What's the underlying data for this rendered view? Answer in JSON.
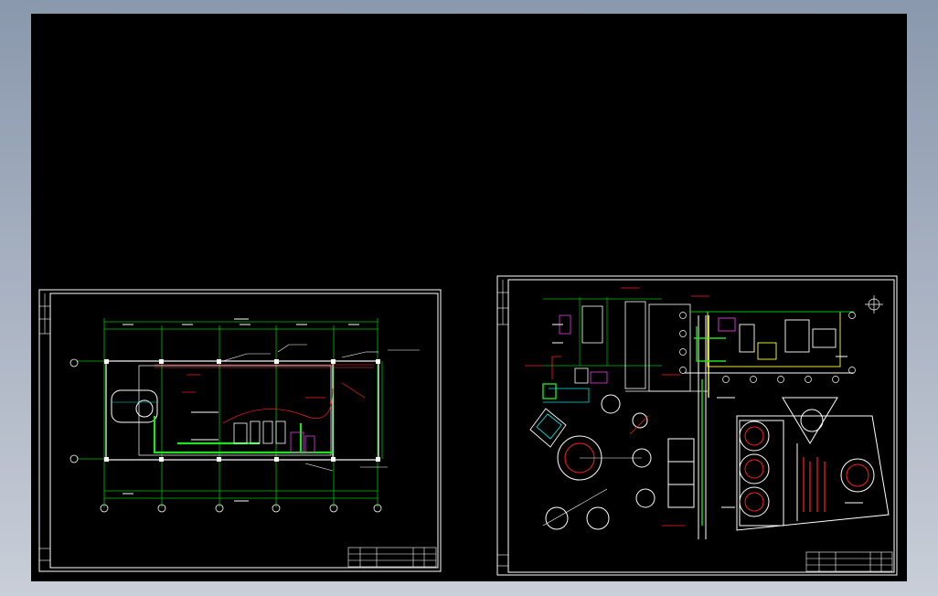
{
  "app": {
    "title": ""
  },
  "sheets": [
    {
      "id": "sheet-1",
      "kind": "piping-plan"
    },
    {
      "id": "sheet-2",
      "kind": "equipment-layout"
    }
  ],
  "grid_axis_labels": {
    "sheet_1_columns": [
      "1",
      "2",
      "3",
      "4",
      "5",
      "6"
    ],
    "sheet_1_rows": [
      "A",
      "B"
    ]
  },
  "colors": {
    "background": "#000000",
    "frame": "#ffffff",
    "dimension": "#00c000",
    "annotation": "#ff2020",
    "pipe_green": "#20e020",
    "structure_yellow": "#ffff40",
    "equipment_magenta": "#e040e0",
    "cyan": "#00e0e0"
  },
  "icons": [
    "north-arrow-icon"
  ]
}
